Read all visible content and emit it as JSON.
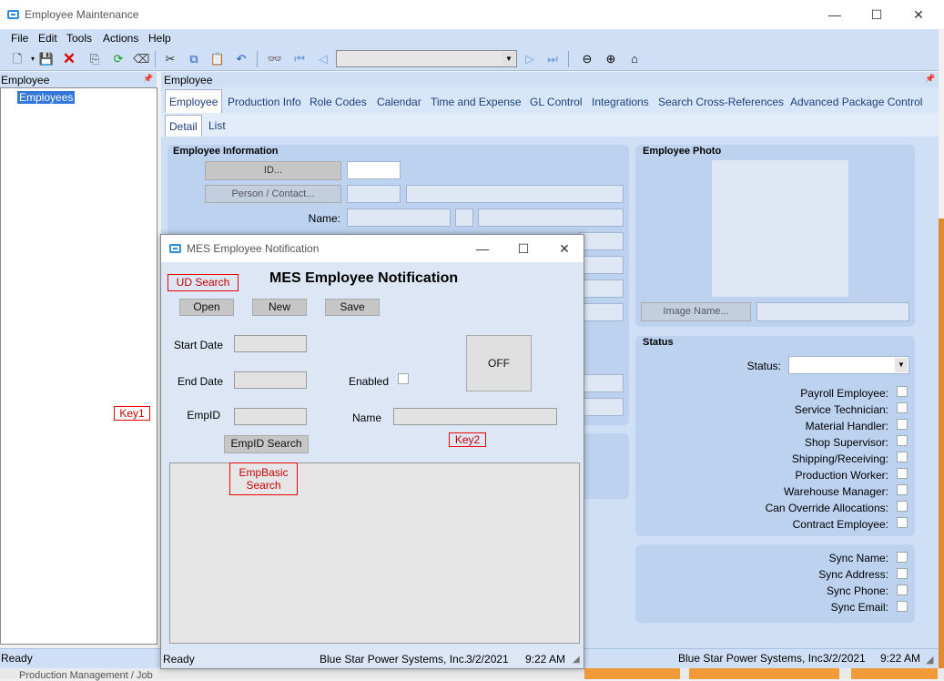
{
  "window": {
    "title": "Employee Maintenance",
    "min": "—",
    "max": "☐",
    "close": "✕"
  },
  "menu": [
    "File",
    "Edit",
    "Tools",
    "Actions",
    "Help"
  ],
  "tree": {
    "header": "Employee",
    "pin": "📌",
    "item": "Employees"
  },
  "main": {
    "header": "Employee",
    "tabs": [
      "Employee",
      "Production Info",
      "Role Codes",
      "Calendar",
      "Time and Expense",
      "GL Control",
      "Integrations",
      "Search Cross-References",
      "Advanced Package Control"
    ],
    "subtabs": [
      "Detail",
      "List"
    ]
  },
  "emp_info": {
    "title": "Employee Information",
    "id_btn": "ID...",
    "person_btn": "Person / Contact...",
    "name_label": "Name:"
  },
  "photo": {
    "title": "Employee Photo",
    "image_btn": "Image Name..."
  },
  "status": {
    "title": "Status",
    "status_label": "Status:",
    "checks": [
      "Payroll Employee:",
      "Service Technician:",
      "Material Handler:",
      "Shop Supervisor:",
      "Shipping/Receiving:",
      "Production Worker:",
      "Warehouse Manager:",
      "Can Override Allocations:",
      "Contract Employee:"
    ]
  },
  "sync": [
    "Sync Name:",
    "Sync Address:",
    "Sync Phone:",
    "Sync Email:"
  ],
  "statusbar": {
    "left": "Ready",
    "company": "Blue Star Power Systems, Inc.",
    "date": "3/2/2021",
    "time": "9:22 AM"
  },
  "bottom_text": "Production Management / Job",
  "annotations": {
    "key1": "Key1",
    "key2": "Key2",
    "ud_search": "UD Search",
    "empbasic": "EmpBasic\nSearch"
  },
  "dialog": {
    "title": "MES Employee Notification",
    "heading": "MES Employee Notification",
    "open": "Open",
    "new": "New",
    "save": "Save",
    "start_date": "Start Date",
    "end_date": "End Date",
    "enabled": "Enabled",
    "empid": "EmpID",
    "name": "Name",
    "off": "OFF",
    "empid_search": "EmpID Search",
    "status": {
      "left": "Ready",
      "company": "Blue Star Power Systems, Inc.",
      "date": "3/2/2021",
      "time": "9:22 AM"
    }
  }
}
